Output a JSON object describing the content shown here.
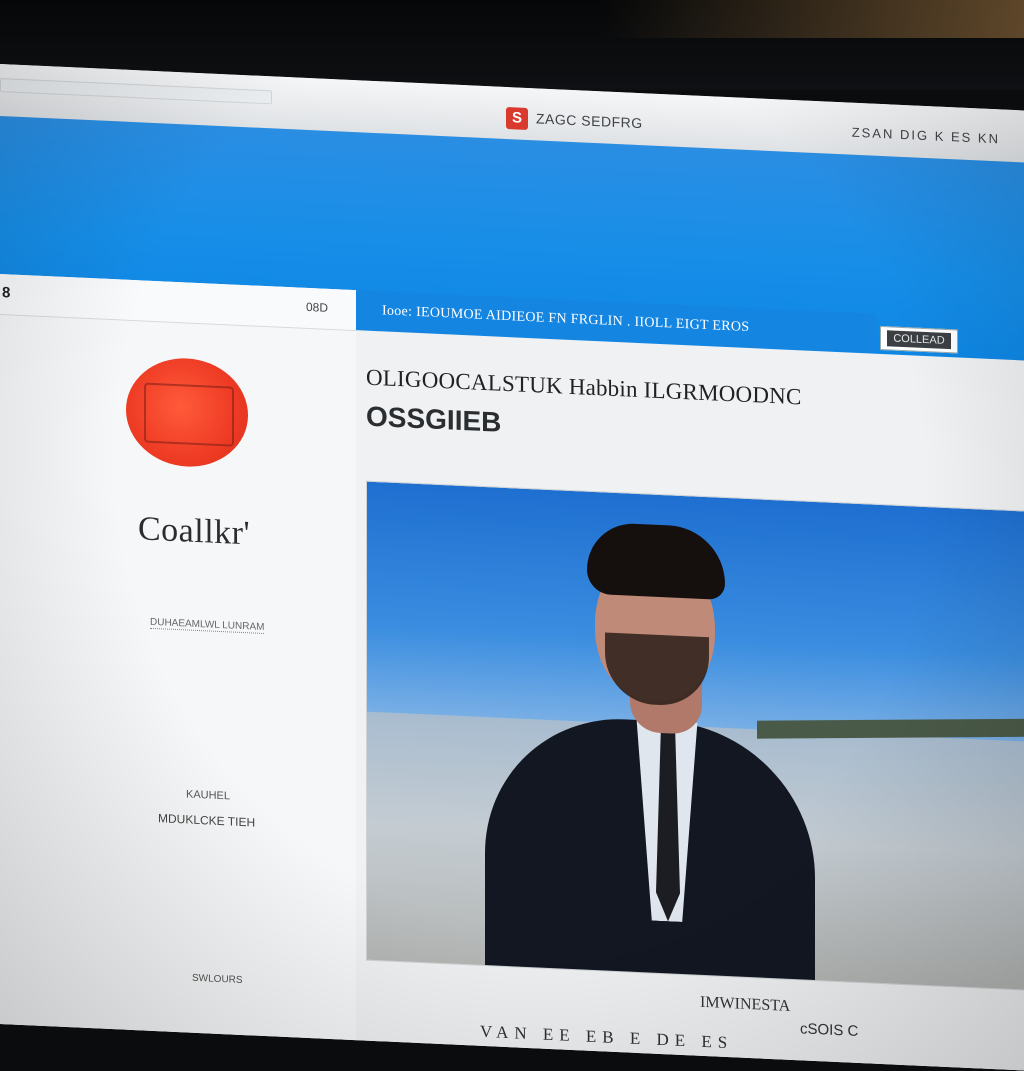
{
  "browser": {
    "icon_glyph": "S",
    "title": "ZAGC SEDFRG",
    "controls": "ZSAN  DIG  K  ES  KN"
  },
  "left_panel": {
    "corner_label": "8",
    "small_icon_label": "08D",
    "site_name": "Coallkr'",
    "meta_line_1": "DUHAEAMLWL LUNRAM",
    "meta_line_2": "KAUHEL",
    "meta_line_3": "MDUKLCKE TIEH",
    "meta_line_4": "SWLOURS"
  },
  "nav": {
    "text": "Iooe:  IEOUMOE AIDIEOE FN FRGLIN . IIOLL EIGT EROS",
    "button_label": "COLLEAD"
  },
  "article": {
    "headline_line_1": "OLIGOOCALSTUK   Habbin ILGRMOODNC",
    "headline_line_2": "OSSGIIEB",
    "caption": "IMWINESTA",
    "footer_note": "cSOIS C",
    "footer_links": "VAN  EE  EB  E  DE  ES"
  },
  "colors": {
    "banner_blue": "#168ee8",
    "nav_blue": "#1486e2",
    "logo_red": "#ee3b24",
    "page_bg": "#f1f3f4"
  }
}
